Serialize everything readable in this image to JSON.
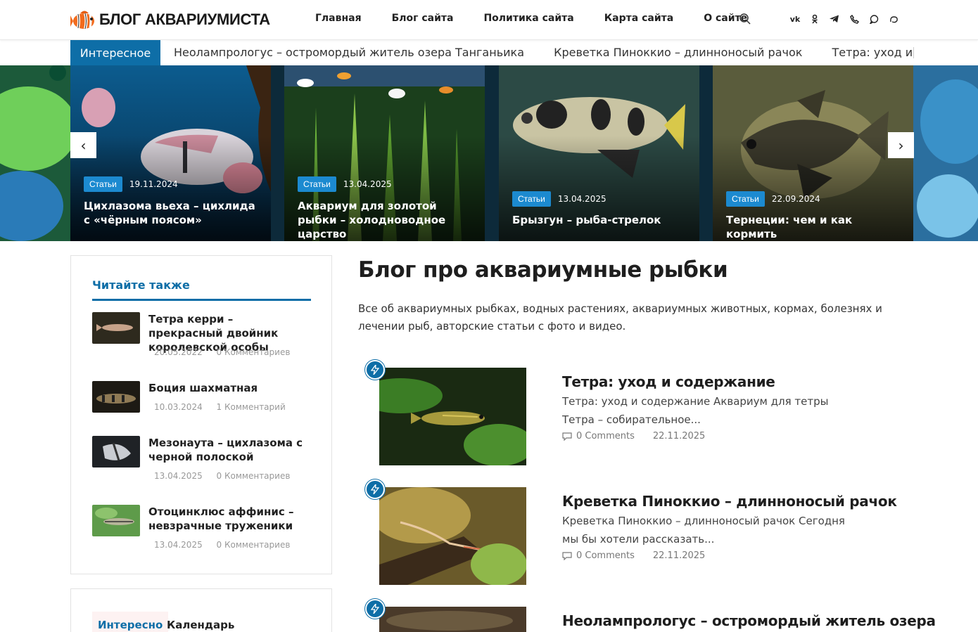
{
  "header": {
    "logo_text": "БЛОГ АКВАРИУМИСТА",
    "nav": [
      "Главная",
      "Блог сайта",
      "Политика сайта",
      "Карта сайта",
      "О сайте"
    ],
    "socials": [
      "vk-icon",
      "odnoklassniki-icon",
      "telegram-icon",
      "viber-icon",
      "whatsapp-icon",
      "max-icon"
    ]
  },
  "ticker": {
    "label": "Интересное",
    "items": [
      "Неолампрологус – остромордый житель озера Танганьика",
      "Креветка Пиноккио – длинноносый рачок",
      "Тетра: уход и содержание"
    ]
  },
  "carousel": {
    "prev_label": "‹",
    "next_label": "›",
    "slides": [
      {
        "badge": "Статьи",
        "date": "19.11.2024",
        "title": "Цихлазома вьеха – цихлида с «чёрным поясом»"
      },
      {
        "badge": "Статьи",
        "date": "13.04.2025",
        "title": "Аквариум для золотой рыбки – холодноводное царство"
      },
      {
        "badge": "Статьи",
        "date": "13.04.2025",
        "title": "Брызгун – рыба-стрелок"
      },
      {
        "badge": "Статьи",
        "date": "22.09.2024",
        "title": "Тернеции: чем и как кормить"
      }
    ]
  },
  "sidebar": {
    "title": "Читайте также",
    "items": [
      {
        "title": "Тетра керри – прекрасный двойник королевской особы",
        "date": "20.05.2022",
        "comments": "0 Комментариев"
      },
      {
        "title": "Боция шахматная",
        "date": "10.03.2024",
        "comments": "1 Комментарий"
      },
      {
        "title": "Мезонаута – цихлазома с черной полоской",
        "date": "13.04.2025",
        "comments": "0 Комментариев"
      },
      {
        "title": "Отоцинклюс аффинис – невзрачные труженики",
        "date": "13.04.2025",
        "comments": "0 Комментариев"
      }
    ],
    "tabs": [
      "Интересно",
      "Календарь"
    ]
  },
  "main": {
    "title": "Блог про аквариумные рыбки",
    "description": "Все об аквариумных рыбках, водных растениях, аквариумных животных, кормах, болезнях и лечении рыб, авторские статьи с фото и видео.",
    "posts": [
      {
        "title": "Тетра: уход и содержание",
        "excerpt": "Тетра: уход и содержание Аквариум для тетры Тетра – собирательное...",
        "comments": "0 Comments",
        "date": "22.11.2025"
      },
      {
        "title": "Креветка Пиноккио – длинноносый рачок",
        "excerpt": "Креветка Пиноккио – длинноносый рачок Сегодня мы бы хотели рассказать...",
        "comments": "0 Comments",
        "date": "22.11.2025"
      },
      {
        "title": "Неолампрологус – остромордый житель озера",
        "excerpt": "",
        "comments": "",
        "date": ""
      }
    ]
  },
  "colors": {
    "accent": "#0e6ea7",
    "badge": "#1c8ad0"
  }
}
